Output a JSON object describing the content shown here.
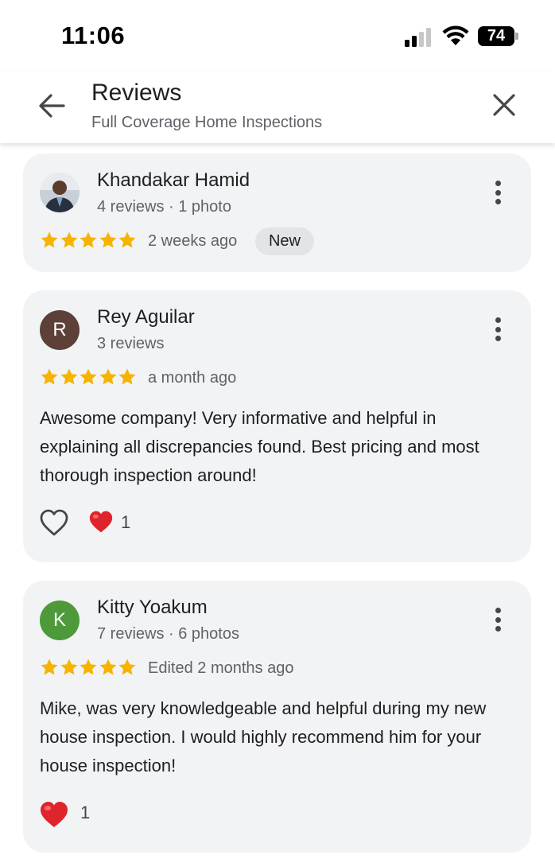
{
  "status_bar": {
    "time": "11:06",
    "battery": "74"
  },
  "header": {
    "title": "Reviews",
    "subtitle": "Full Coverage Home Inspections"
  },
  "reviews": [
    {
      "name": "Khandakar Hamid",
      "meta": "4 reviews · 1 photo",
      "rating": 5,
      "date": "2 weeks ago",
      "badge": "New",
      "avatar_type": "photo"
    },
    {
      "name": "Rey Aguilar",
      "meta": "3 reviews",
      "rating": 5,
      "date": "a month ago",
      "avatar_letter": "R",
      "avatar_color": "#5d4037",
      "text": "Awesome company! Very informative and helpful in explaining all discrepancies found. Best pricing and most thorough inspection around!",
      "heart_count": "1"
    },
    {
      "name": "Kitty Yoakum",
      "meta": "7 reviews · 6 photos",
      "rating": 5,
      "date": "Edited 2 months ago",
      "avatar_letter": "K",
      "avatar_color": "#4e9a3a",
      "text": "Mike, was very knowledgeable and helpful during my new house inspection. I would highly recommend him for your house inspection!",
      "heart_count": "1"
    }
  ],
  "colors": {
    "star": "#f6b400",
    "heart": "#e0242c"
  }
}
